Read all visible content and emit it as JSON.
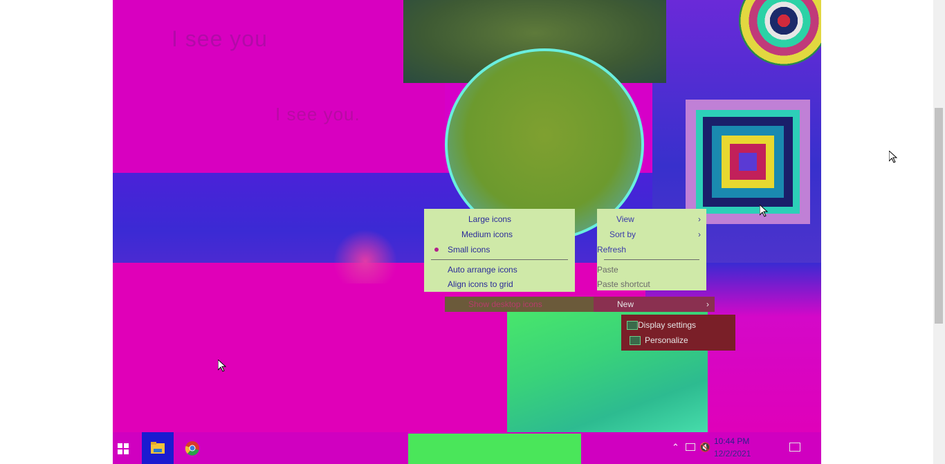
{
  "desktop": {
    "wallpaper_text_1": "I see you",
    "wallpaper_text_2": "I see you."
  },
  "context_menu": {
    "view_submenu": {
      "large_icons": "Large icons",
      "medium_icons": "Medium icons",
      "small_icons": "Small icons",
      "auto_arrange": "Auto arrange icons",
      "align_to_grid": "Align icons to grid",
      "show_desktop_icons": "Show desktop icons"
    },
    "main": {
      "view": "View",
      "sort_by": "Sort by",
      "refresh": "Refresh",
      "paste": "Paste",
      "paste_shortcut": "Paste shortcut",
      "new": "New"
    },
    "bottom": {
      "display_settings": "Display settings",
      "personalize": "Personalize"
    }
  },
  "taskbar": {
    "clock_time": "10:44 PM",
    "clock_date": "12/2/2021",
    "pinned": [
      "start-icon",
      "file-explorer-icon",
      "chrome-icon"
    ],
    "tray_icons": [
      "chevron-up-icon",
      "network-icon",
      "volume-muted-icon",
      "notification-icon"
    ]
  },
  "colors": {
    "accent_magenta": "#d600c8",
    "menu_bg": "#cfe9a8",
    "taskbar_active": "#1b1bd0"
  }
}
